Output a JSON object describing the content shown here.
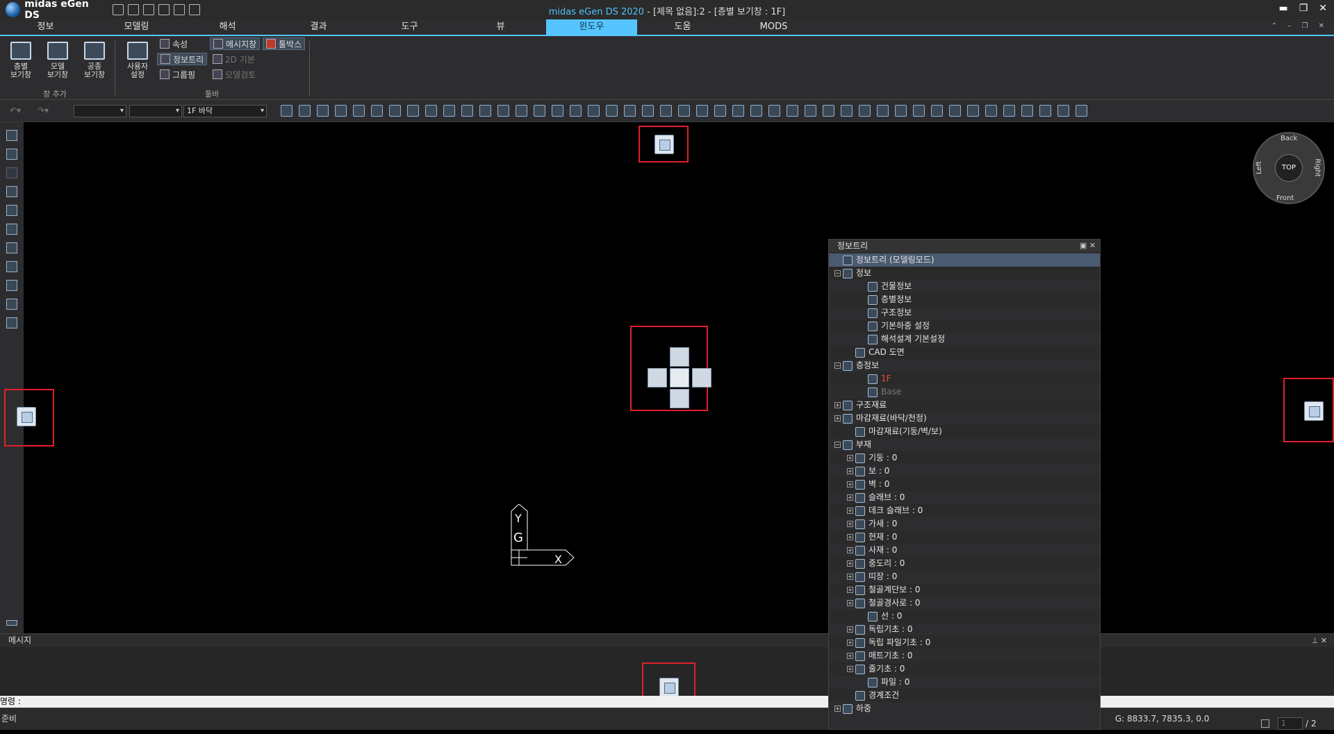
{
  "app": {
    "logo_text": "midas eGen DS",
    "title_app": "midas eGen DS 2020",
    "title_rest": " - [제목 없음]:2 - [층별 보기창 : 1F]"
  },
  "window_controls": {
    "minimize": "▬",
    "restore": "❐",
    "close": "✕"
  },
  "menu": [
    "정보",
    "모델링",
    "해석",
    "결과",
    "도구",
    "뷰",
    "윈도우",
    "도움",
    "MODS"
  ],
  "menu_active_index": 6,
  "ribbon": {
    "big_buttons": [
      {
        "label": "층별\n보기창"
      },
      {
        "label": "모델\n보기창"
      },
      {
        "label": "공종\n보기창"
      },
      {
        "label": "사용자\n설정"
      }
    ],
    "small_buttons": [
      {
        "label": "속성"
      },
      {
        "label": "정보트리"
      },
      {
        "label": "그룹핑"
      },
      {
        "label": "메시지창"
      },
      {
        "label": "2D 기본"
      },
      {
        "label": "모델검토"
      },
      {
        "label": "툴박스"
      }
    ],
    "groups": [
      "창 추가",
      "툴바"
    ]
  },
  "toolbar": {
    "floor_combo": "1F 바닥"
  },
  "viewport": {
    "axis": {
      "y": "Y",
      "g": "G",
      "x": "X"
    },
    "navcube": {
      "top": "TOP",
      "back": "Back",
      "front": "Front",
      "left": "Left",
      "right": "Right"
    }
  },
  "panel": {
    "title": "정보트리",
    "tree": [
      {
        "label": "정보트리 (모델링모드)",
        "level": 0,
        "pm": "",
        "sel": true
      },
      {
        "label": "정보",
        "level": 0,
        "pm": "−"
      },
      {
        "label": "건물정보",
        "level": 2,
        "pm": ""
      },
      {
        "label": "층별정보",
        "level": 2,
        "pm": ""
      },
      {
        "label": "구조정보",
        "level": 2,
        "pm": ""
      },
      {
        "label": "기본하중 설정",
        "level": 2,
        "pm": ""
      },
      {
        "label": "해석설계 기본설정",
        "level": 2,
        "pm": ""
      },
      {
        "label": "CAD 도면",
        "level": 1,
        "pm": ""
      },
      {
        "label": "층정보",
        "level": 0,
        "pm": "−"
      },
      {
        "label": "1F",
        "level": 2,
        "pm": "",
        "cls": "red"
      },
      {
        "label": "Base",
        "level": 2,
        "pm": "",
        "cls": "gray"
      },
      {
        "label": "구조재료",
        "level": 0,
        "pm": "+"
      },
      {
        "label": "마감재료(바닥/천정)",
        "level": 0,
        "pm": "+"
      },
      {
        "label": "마감재료(기둥/벽/보)",
        "level": 1,
        "pm": ""
      },
      {
        "label": "부재",
        "level": 0,
        "pm": "−"
      },
      {
        "label": "기둥 : 0",
        "level": 1,
        "pm": "+"
      },
      {
        "label": "보 : 0",
        "level": 1,
        "pm": "+"
      },
      {
        "label": "벽 : 0",
        "level": 1,
        "pm": "+"
      },
      {
        "label": "슬래브 : 0",
        "level": 1,
        "pm": "+"
      },
      {
        "label": "데크 슬래브 : 0",
        "level": 1,
        "pm": "+"
      },
      {
        "label": "가새 : 0",
        "level": 1,
        "pm": "+"
      },
      {
        "label": "현재 : 0",
        "level": 1,
        "pm": "+"
      },
      {
        "label": "사재 : 0",
        "level": 1,
        "pm": "+"
      },
      {
        "label": "중도리 : 0",
        "level": 1,
        "pm": "+"
      },
      {
        "label": "띠장 : 0",
        "level": 1,
        "pm": "+"
      },
      {
        "label": "철골계단보 : 0",
        "level": 1,
        "pm": "+"
      },
      {
        "label": "철골경사로 : 0",
        "level": 1,
        "pm": "+"
      },
      {
        "label": "선 : 0",
        "level": 2,
        "pm": ""
      },
      {
        "label": "독립기초 : 0",
        "level": 1,
        "pm": "+"
      },
      {
        "label": "독립 파일기초 : 0",
        "level": 1,
        "pm": "+"
      },
      {
        "label": "매트기초 : 0",
        "level": 1,
        "pm": "+"
      },
      {
        "label": "줄기초 : 0",
        "level": 1,
        "pm": "+"
      },
      {
        "label": "파일 : 0",
        "level": 2,
        "pm": ""
      },
      {
        "label": "경계조건",
        "level": 1,
        "pm": ""
      },
      {
        "label": "하중",
        "level": 0,
        "pm": "+"
      }
    ]
  },
  "message": {
    "title": "메시지"
  },
  "command": {
    "label": "명령 :"
  },
  "status": {
    "text": "준비",
    "coord": "G: 8833.7, 7835.3, 0.0",
    "page_current": "1",
    "page_sep": "/",
    "page_total": "2"
  }
}
